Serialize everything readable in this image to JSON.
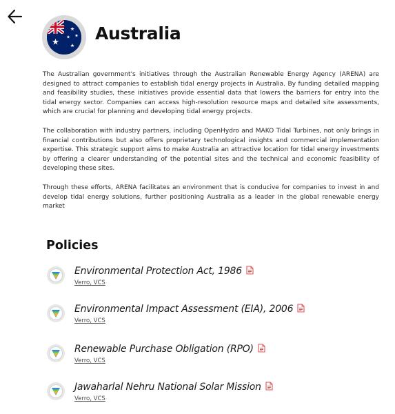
{
  "header": {
    "back_icon": "arrow-left-icon",
    "flag_icon": "australia-flag-icon",
    "title": "Australia"
  },
  "description": {
    "paragraphs": [
      "The Australian government's initiatives through the Australian Renewable Energy Agency (ARENA) are designed to attract companies to establish tidal energy projects in Australia. By funding detailed mapping and feasibility studies, these initiatives provide essential data that lowers the barriers for entry into the tidal energy sector. Companies can access high-resolution resource maps and detailed site assessments, which are crucial for planning and developing tidal energy projects.",
      "The collaboration with industry partners, including OpenHydro and MAKO Tidal Turbines, not only brings in financial contributions but also offers proprietary technological insights and commercial implementation expertise. This strategic support aims to make Australia an attractive location for tidal energy investments by offering a clearer understanding of the potential sites and the technical and economic feasibility of developing these sites.",
      "Through these efforts, ARENA facilitates an environment that is conducive for companies to invest in and develop tidal energy solutions, further positioning Australia as a leader in the global renewable energy market"
    ]
  },
  "policies": {
    "title": "Policies",
    "items": [
      {
        "name": "Environmental Protection Act, 1986",
        "source": "Verro, VCS",
        "icon": "verra-logo-icon",
        "doc_icon": "pdf-icon"
      },
      {
        "name": "Environmental Impact Assessment (EIA), 2006",
        "source": "Verro, VCS",
        "icon": "verra-logo-icon",
        "doc_icon": "pdf-icon"
      },
      {
        "name": "Renewable Purchase Obligation (RPO)",
        "source": "Verro, VCS",
        "icon": "verra-logo-icon",
        "doc_icon": "pdf-icon"
      },
      {
        "name": "Jawaharlal Nehru National Solar Mission",
        "source": "Verro, VCS",
        "icon": "verra-logo-icon",
        "doc_icon": "pdf-icon"
      }
    ]
  },
  "colors": {
    "pdf_icon": "#e05555",
    "flag_blue": "#012169",
    "flag_red": "#c8102e"
  }
}
